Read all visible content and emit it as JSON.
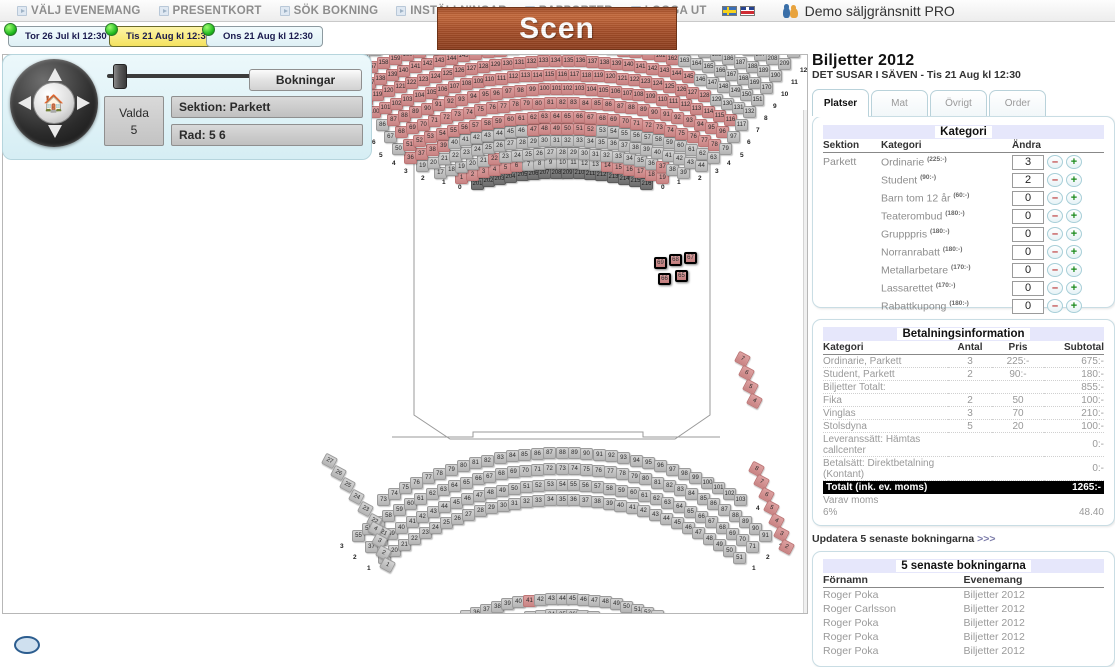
{
  "topbar": {
    "menu": [
      {
        "label": "VÄLJ EVENEMANG",
        "icon": "page-icon"
      },
      {
        "label": "PRESENTKORT",
        "icon": "page-icon"
      },
      {
        "label": "SÖK BOKNING",
        "icon": "page-icon"
      },
      {
        "label": "INSTÄLLNINGAR",
        "icon": "page-icon"
      },
      {
        "label": "RAPPORTER",
        "icon": "page-icon"
      },
      {
        "label": "LOGGA UT",
        "icon": "page-icon"
      }
    ],
    "flags": [
      "flag-sweden",
      "flag-uk"
    ],
    "user": "Demo säljgränsnitt PRO"
  },
  "date_tabs": [
    {
      "label": "Tor 26 Jul kl 12:30",
      "active": false
    },
    {
      "label": "Tis 21 Aug kl 12:30",
      "active": true
    },
    {
      "label": "Ons 21 Aug kl 12:30",
      "active": false
    }
  ],
  "controls": {
    "navpad_icon": "home-icon",
    "zoom_slider_value": 10,
    "bookings_button": "Bokningar",
    "valda_label": "Valda",
    "valda_count": "5",
    "section_field": "Sektion: Parkett",
    "row_field": "Rad: 5 6"
  },
  "map": {
    "stage_label": "Scen",
    "legend": {
      "free_color": "#c4c4c4",
      "booked_color": "#d09090",
      "dark_color": "#7d7d7d",
      "selected_border": "#000000"
    }
  },
  "right": {
    "title": "Biljetter 2012",
    "subtitle": "DET SUSAR I SÄVEN - Tis 21 Aug kl 12:30",
    "tabs": [
      {
        "label": "Platser",
        "active": true
      },
      {
        "label": "Mat",
        "active": false
      },
      {
        "label": "Övrigt",
        "active": false
      },
      {
        "label": "Order",
        "active": false
      }
    ],
    "category_card": {
      "header": "Kategori",
      "columns": [
        "Sektion",
        "Kategori",
        "Ändra"
      ],
      "rows": [
        {
          "section": "Parkett",
          "category": "Ordinarie",
          "price": "225:-",
          "qty": "3"
        },
        {
          "section": "",
          "category": "Student",
          "price": "90:-",
          "qty": "2"
        },
        {
          "section": "",
          "category": "Barn tom 12 år",
          "price": "60:-",
          "qty": "0"
        },
        {
          "section": "",
          "category": "Teaterombud",
          "price": "180:-",
          "qty": "0"
        },
        {
          "section": "",
          "category": "Grupppris",
          "price": "180:-",
          "qty": "0"
        },
        {
          "section": "",
          "category": "Norranrabatt",
          "price": "180:-",
          "qty": "0"
        },
        {
          "section": "",
          "category": "Metallarbetare",
          "price": "170:-",
          "qty": "0"
        },
        {
          "section": "",
          "category": "Lassarettet",
          "price": "170:-",
          "qty": "0"
        },
        {
          "section": "",
          "category": "Rabattkupong",
          "price": "180:-",
          "qty": "0"
        }
      ],
      "minus_label": "–",
      "plus_label": "+"
    },
    "payment_card": {
      "header": "Betalningsinformation",
      "columns": [
        "Kategori",
        "Antal",
        "Pris",
        "Subtotal"
      ],
      "rows": [
        {
          "cat": "Ordinarie, Parkett",
          "qty": "3",
          "price": "225:-",
          "subtotal": "675:-"
        },
        {
          "cat": "Student, Parkett",
          "qty": "2",
          "price": "90:-",
          "subtotal": "180:-"
        },
        {
          "cat": "Biljetter Totalt:",
          "qty": "",
          "price": "",
          "subtotal": "855:-"
        },
        {
          "cat": "Fika",
          "qty": "2",
          "price": "50",
          "subtotal": "100:-"
        },
        {
          "cat": "Vinglas",
          "qty": "3",
          "price": "70",
          "subtotal": "210:-"
        },
        {
          "cat": "Stolsdyna",
          "qty": "5",
          "price": "20",
          "subtotal": "100:-"
        },
        {
          "cat": "Leveranssätt: Hämtas callcenter",
          "qty": "",
          "price": "",
          "subtotal": "0:-"
        },
        {
          "cat": "Betalsätt: Direktbetalning (Kontant)",
          "qty": "",
          "price": "",
          "subtotal": "0:-"
        }
      ],
      "total_label": "Totalt (ink. ev. moms)",
      "total_value": "1265:-",
      "vat_label": "Varav moms",
      "vat_rate": "6%",
      "vat_value": "48.40"
    },
    "update_link": "Updatera 5 senaste bokningarna",
    "update_arrows": ">>>",
    "last_card": {
      "header": "5 senaste bokningarna",
      "columns": [
        "Förnamn",
        "Evenemang"
      ],
      "rows": [
        {
          "name": "Roger Poka",
          "event": "Biljetter 2012"
        },
        {
          "name": "Roger Carlsson",
          "event": "Biljetter 2012"
        },
        {
          "name": "Roger Poka",
          "event": "Biljetter 2012"
        },
        {
          "name": "Roger Poka",
          "event": "Biljetter 2012"
        },
        {
          "name": "Roger Poka",
          "event": "Biljetter 2012"
        }
      ]
    }
  }
}
